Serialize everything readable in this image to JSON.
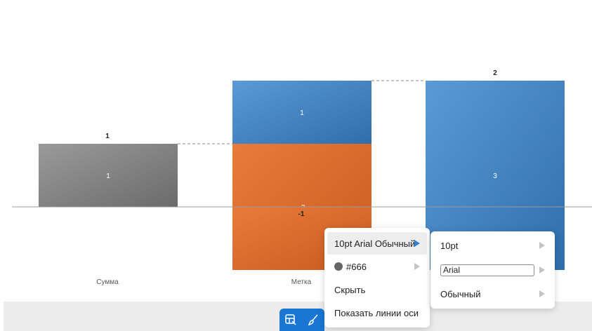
{
  "chart_data": {
    "type": "waterfall",
    "categories": [
      "Сумма",
      "Метка",
      ""
    ],
    "bars": [
      {
        "category": "Сумма",
        "segments": [
          {
            "from": 0,
            "to": 1,
            "label": "1",
            "color": "#7a7a7a"
          }
        ],
        "total_label": "1"
      },
      {
        "category": "Метка",
        "segments": [
          {
            "from": 1,
            "to": -1,
            "label": "-2",
            "color": "#dd6a2a"
          },
          {
            "from": -1,
            "to": 0,
            "label": "",
            "color": "#dd6a2a"
          },
          {
            "from": 1,
            "to": 2,
            "label": "1",
            "color": "#3f86c6"
          }
        ],
        "below_label": "-1"
      },
      {
        "category": "",
        "segments": [
          {
            "from": 0,
            "to": -1,
            "label": "",
            "color": "#dd6a2a"
          },
          {
            "from": -1,
            "to": 2,
            "label": "3",
            "color": "#3f86c6"
          }
        ],
        "total_label": "2"
      }
    ],
    "ylim": [
      -1,
      3
    ],
    "connector_lines": true
  },
  "colors": {
    "accent": "#1976d2",
    "orange": "#dd6a2a",
    "blue": "#3f86c6",
    "gray": "#7a7a7a"
  },
  "context_menu": {
    "items": [
      {
        "label": "10pt Arial Обычный",
        "active": true,
        "has_submenu": true
      },
      {
        "label": "#666",
        "swatch": "#666666",
        "has_submenu": true
      },
      {
        "label": "Скрыть"
      },
      {
        "label": "Показать линии оси"
      }
    ]
  },
  "submenu": {
    "size_label": "10pt",
    "font_value": "Arial",
    "style_label": "Обычный"
  },
  "toolbar": {
    "icons": [
      "format-icon",
      "brush-icon"
    ]
  }
}
